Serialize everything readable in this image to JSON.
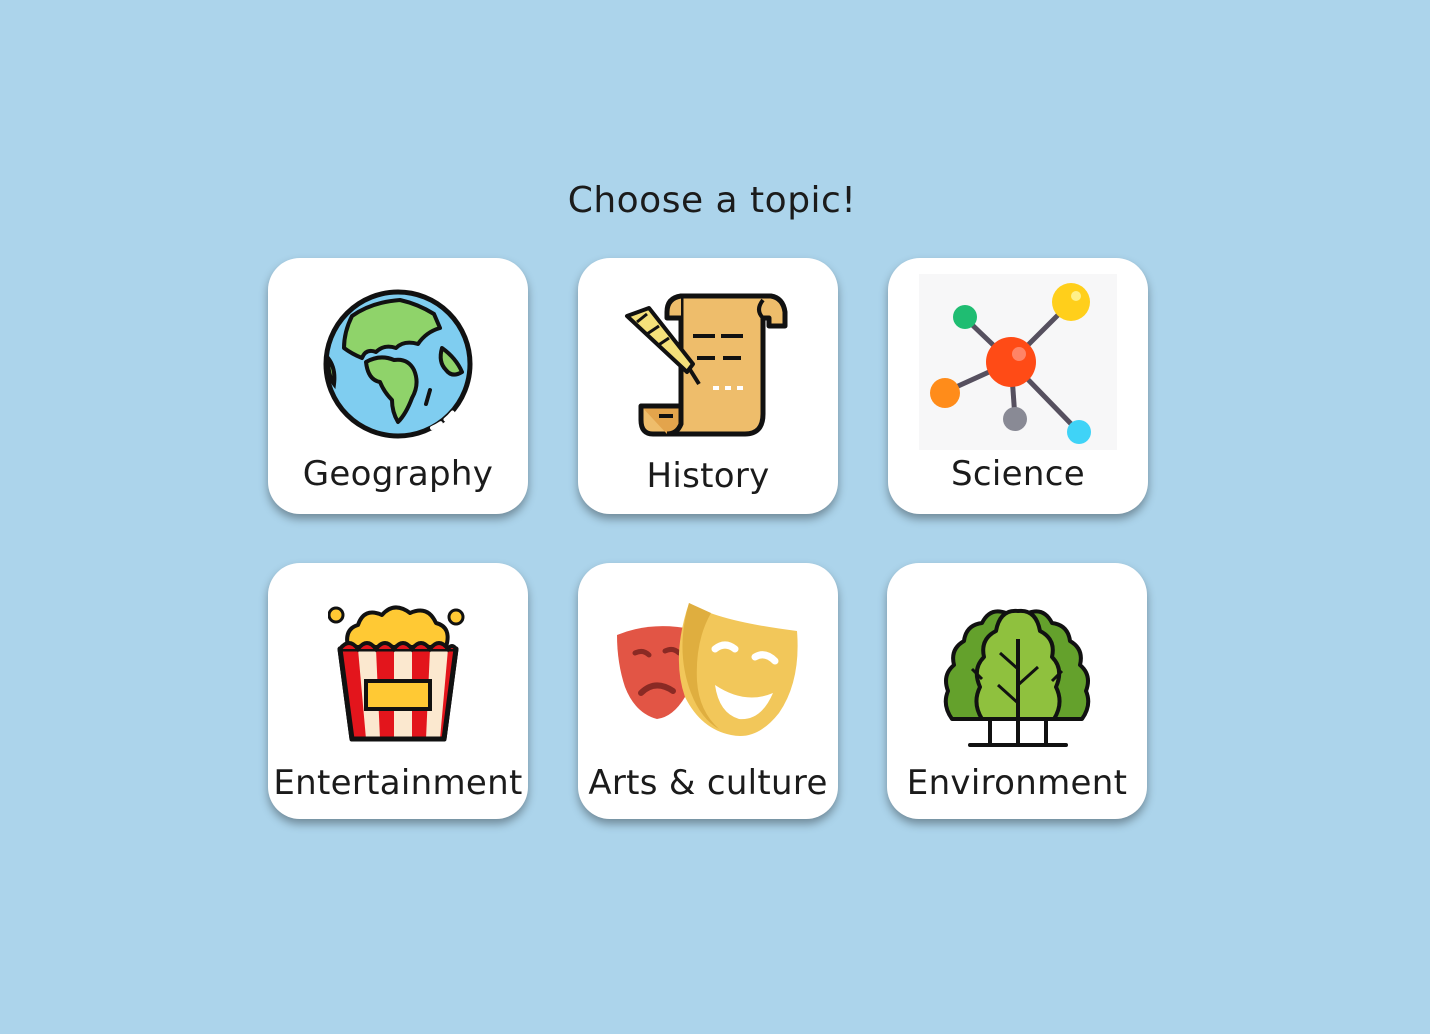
{
  "heading": "Choose a topic!",
  "topics": [
    {
      "label": "Geography",
      "icon": "globe-icon"
    },
    {
      "label": "History",
      "icon": "scroll-quill-icon"
    },
    {
      "label": "Science",
      "icon": "molecule-icon"
    },
    {
      "label": "Entertainment",
      "icon": "popcorn-icon"
    },
    {
      "label": "Arts & culture",
      "icon": "theater-masks-icon"
    },
    {
      "label": "Environment",
      "icon": "trees-icon"
    }
  ],
  "colors": {
    "background": "#acd4eb",
    "card": "#ffffff",
    "text": "#1b1b1b"
  }
}
